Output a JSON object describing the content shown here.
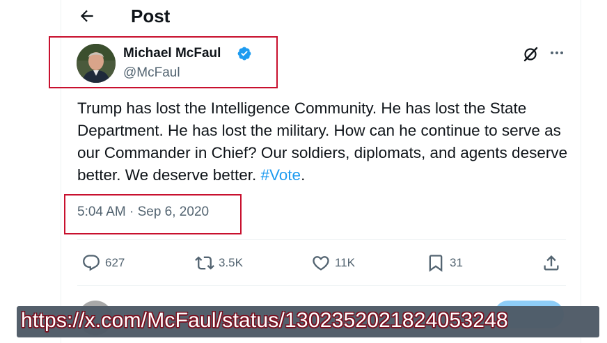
{
  "header": {
    "title": "Post"
  },
  "tweet": {
    "author_name": "Michael McFaul",
    "handle": "@McFaul",
    "text": "Trump has lost the Intelligence Community. He has lost the State Department. He has lost the military. How can he continue to serve as our Commander in Chief?  Our soldiers, diplomats, and agents deserve better. We deserve better.  ",
    "hashtag": "#Vote",
    "text_end": ".",
    "timestamp": "5:04 AM · Sep 6, 2020"
  },
  "actions": {
    "replies": "627",
    "reposts": "3.5K",
    "likes": "11K",
    "bookmarks": "31"
  },
  "overlay": {
    "url": "https://x.com/McFaul/status/1302352021824053248"
  },
  "colors": {
    "accent": "#1d9bf0",
    "highlight_box": "#c8102e",
    "muted": "#536471"
  },
  "icons": [
    "back-arrow-icon",
    "verified-badge-icon",
    "grok-icon",
    "more-icon",
    "reply-icon",
    "repost-icon",
    "like-icon",
    "bookmark-icon",
    "share-icon"
  ]
}
